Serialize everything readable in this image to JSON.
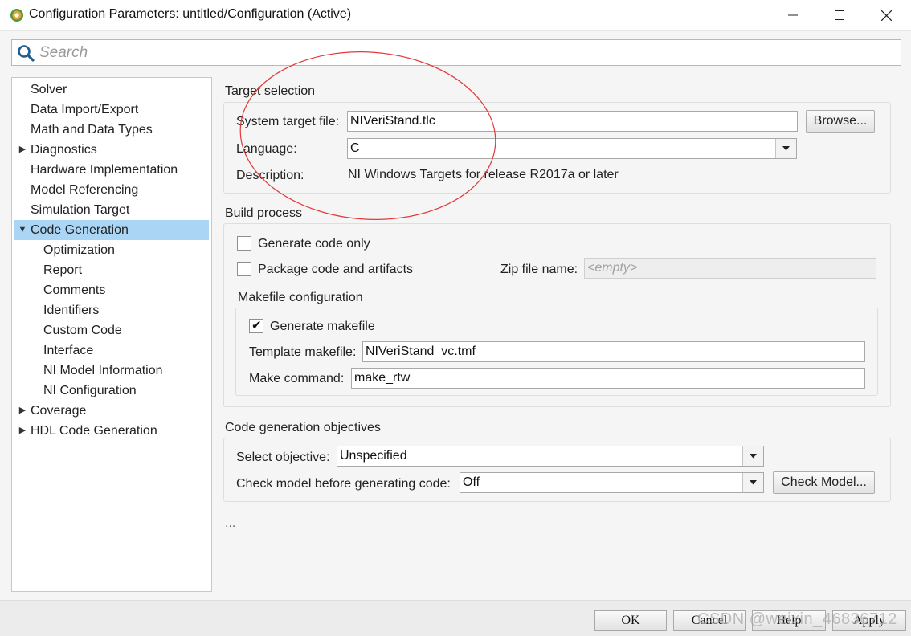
{
  "window": {
    "title": "Configuration Parameters: untitled/Configuration (Active)",
    "app_icon": "gear-cog-icon",
    "controls": [
      "minimize-icon",
      "maximize-icon",
      "close-icon"
    ]
  },
  "search": {
    "placeholder": "Search",
    "value": ""
  },
  "tree": {
    "items": [
      {
        "label": "Solver",
        "level": 0,
        "arrow": ""
      },
      {
        "label": "Data Import/Export",
        "level": 0,
        "arrow": ""
      },
      {
        "label": "Math and Data Types",
        "level": 0,
        "arrow": ""
      },
      {
        "label": "Diagnostics",
        "level": 0,
        "arrow": "▶"
      },
      {
        "label": "Hardware Implementation",
        "level": 0,
        "arrow": ""
      },
      {
        "label": "Model Referencing",
        "level": 0,
        "arrow": ""
      },
      {
        "label": "Simulation Target",
        "level": 0,
        "arrow": ""
      },
      {
        "label": "Code Generation",
        "level": 0,
        "arrow": "▼",
        "selected": true
      },
      {
        "label": "Optimization",
        "level": 1,
        "arrow": ""
      },
      {
        "label": "Report",
        "level": 1,
        "arrow": ""
      },
      {
        "label": "Comments",
        "level": 1,
        "arrow": ""
      },
      {
        "label": "Identifiers",
        "level": 1,
        "arrow": ""
      },
      {
        "label": "Custom Code",
        "level": 1,
        "arrow": ""
      },
      {
        "label": "Interface",
        "level": 1,
        "arrow": ""
      },
      {
        "label": "NI Model Information",
        "level": 1,
        "arrow": ""
      },
      {
        "label": "NI Configuration",
        "level": 1,
        "arrow": ""
      },
      {
        "label": "Coverage",
        "level": 0,
        "arrow": "▶"
      },
      {
        "label": "HDL Code Generation",
        "level": 0,
        "arrow": "▶"
      }
    ],
    "selected_color": "#abd5f5"
  },
  "target_selection": {
    "title": "Target selection",
    "system_target_file_label": "System target file:",
    "system_target_file_value": "NIVeriStand.tlc",
    "browse_label": "Browse...",
    "language_label": "Language:",
    "language_value": "C",
    "description_label": "Description:",
    "description_value": "NI Windows Targets for release R2017a or later"
  },
  "build_process": {
    "title": "Build process",
    "generate_code_only_label": "Generate code only",
    "generate_code_only_checked": false,
    "package_code_label": "Package code and artifacts",
    "package_code_checked": false,
    "zip_file_name_label": "Zip file name:",
    "zip_file_name_placeholder": "<empty>"
  },
  "makefile": {
    "title": "Makefile configuration",
    "generate_makefile_label": "Generate makefile",
    "generate_makefile_checked": true,
    "template_makefile_label": "Template makefile:",
    "template_makefile_value": "NIVeriStand_vc.tmf",
    "make_command_label": "Make command:",
    "make_command_value": "make_rtw"
  },
  "objectives": {
    "title": "Code generation objectives",
    "select_objective_label": "Select objective:",
    "select_objective_value": "Unspecified",
    "check_model_label": "Check model before generating code:",
    "check_model_value": "Off",
    "check_model_button": "Check Model..."
  },
  "ellipsis": "...",
  "footer": {
    "ok": "OK",
    "cancel": "Cancel",
    "help": "Help",
    "apply": "Apply"
  },
  "watermark": "CSDN @weixin_46836712",
  "colors": {
    "annotation_circle": "#e03a3a",
    "accent": "#abd5f5"
  }
}
